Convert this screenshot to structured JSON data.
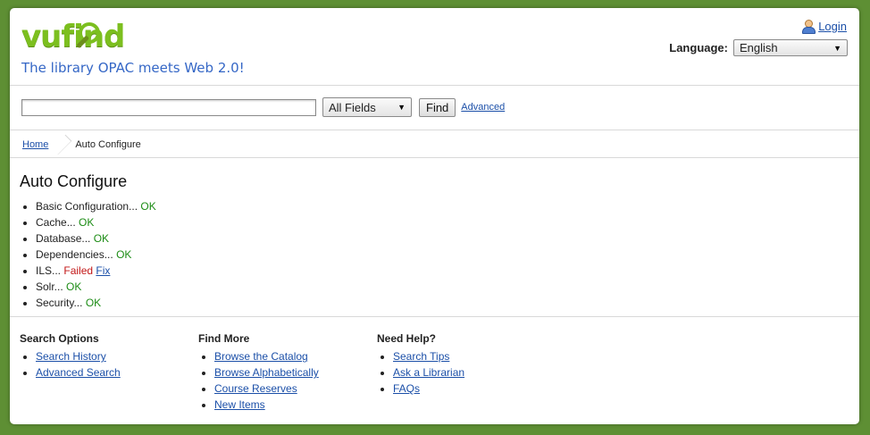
{
  "header": {
    "logo_text": "vufind",
    "tagline": "The library OPAC meets Web 2.0!",
    "login_label": "Login",
    "language_label": "Language:",
    "language_selected": "English"
  },
  "search": {
    "value": "",
    "field_selected": "All Fields",
    "find_label": "Find",
    "advanced_label": "Advanced"
  },
  "breadcrumb": {
    "home": "Home",
    "current": "Auto Configure"
  },
  "main": {
    "title": "Auto Configure",
    "checks": [
      {
        "label": "Basic Configuration...",
        "status": "OK"
      },
      {
        "label": "Cache...",
        "status": "OK"
      },
      {
        "label": "Database...",
        "status": "OK"
      },
      {
        "label": "Dependencies...",
        "status": "OK"
      },
      {
        "label": "ILS...",
        "status": "Failed",
        "fix": "Fix"
      },
      {
        "label": "Solr...",
        "status": "OK"
      },
      {
        "label": "Security...",
        "status": "OK"
      }
    ]
  },
  "footer": {
    "columns": [
      {
        "title": "Search Options",
        "links": [
          "Search History",
          "Advanced Search"
        ]
      },
      {
        "title": "Find More",
        "links": [
          "Browse the Catalog",
          "Browse Alphabetically",
          "Course Reserves",
          "New Items"
        ]
      },
      {
        "title": "Need Help?",
        "links": [
          "Search Tips",
          "Ask a Librarian",
          "FAQs"
        ]
      }
    ]
  },
  "colors": {
    "background": "#5e8f34",
    "logo_green": "#7cbf1f",
    "tagline_blue": "#3567c6",
    "ok_green": "#1c8c15",
    "failed_red": "#c21616",
    "link_blue": "#1b4fa8"
  },
  "icons": {
    "user": "user-icon",
    "dropdown": "chevron-down-icon",
    "logo_lens": "magnifier-icon"
  }
}
